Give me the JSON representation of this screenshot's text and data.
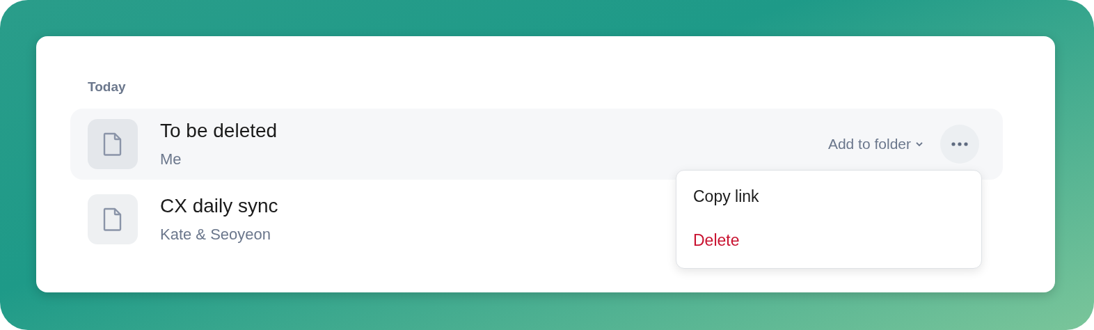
{
  "section": {
    "title": "Today"
  },
  "rows": [
    {
      "title": "To be deleted",
      "owner": "Me",
      "selected": true,
      "folder_button": "Add to folder"
    },
    {
      "title": "CX daily sync",
      "owner": "Kate & Seoyeon",
      "selected": false
    }
  ],
  "menu": {
    "open": true,
    "items": [
      {
        "label": "Copy link",
        "kind": "normal"
      },
      {
        "label": "Delete",
        "kind": "danger"
      }
    ]
  }
}
